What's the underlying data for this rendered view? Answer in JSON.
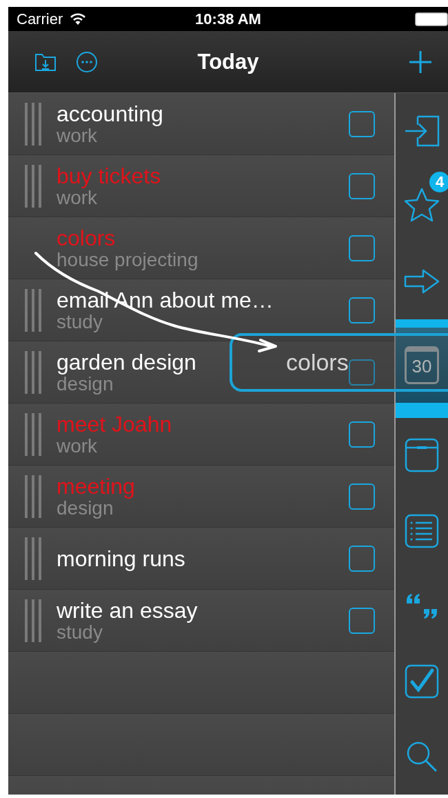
{
  "status_bar": {
    "carrier": "Carrier",
    "time": "10:38 AM"
  },
  "nav_bar": {
    "title": "Today"
  },
  "tasks": [
    {
      "title": "accounting",
      "subtitle": "work",
      "important": false,
      "checked": false,
      "dragging": false
    },
    {
      "title": "buy tickets",
      "subtitle": "work",
      "important": true,
      "checked": false,
      "dragging": false
    },
    {
      "title": "colors",
      "subtitle": "house projecting",
      "important": true,
      "checked": false,
      "dragging": true
    },
    {
      "title": "email Ann about me…",
      "subtitle": "study",
      "important": false,
      "checked": false,
      "dragging": false
    },
    {
      "title": "garden design",
      "subtitle": "design",
      "important": false,
      "checked": false,
      "dragging": false
    },
    {
      "title": "meet Joahn",
      "subtitle": "work",
      "important": true,
      "checked": false,
      "dragging": false
    },
    {
      "title": "meeting",
      "subtitle": "design",
      "important": true,
      "checked": false,
      "dragging": false
    },
    {
      "title": "morning runs",
      "important": false,
      "checked": false,
      "dragging": false
    },
    {
      "title": "write an essay",
      "subtitle": "study",
      "important": false,
      "checked": false,
      "dragging": false
    }
  ],
  "sidebar": {
    "items": [
      {
        "kind": "import",
        "selected": false
      },
      {
        "kind": "star",
        "badge": "4",
        "selected": false
      },
      {
        "kind": "forward",
        "selected": false
      },
      {
        "kind": "calendar",
        "label": "30",
        "selected": true
      },
      {
        "kind": "inbox",
        "selected": false
      },
      {
        "kind": "list",
        "selected": false
      },
      {
        "kind": "quote",
        "selected": false
      },
      {
        "kind": "check",
        "selected": false
      },
      {
        "kind": "search",
        "selected": false
      }
    ]
  },
  "drag_preview": {
    "label": "colors"
  }
}
